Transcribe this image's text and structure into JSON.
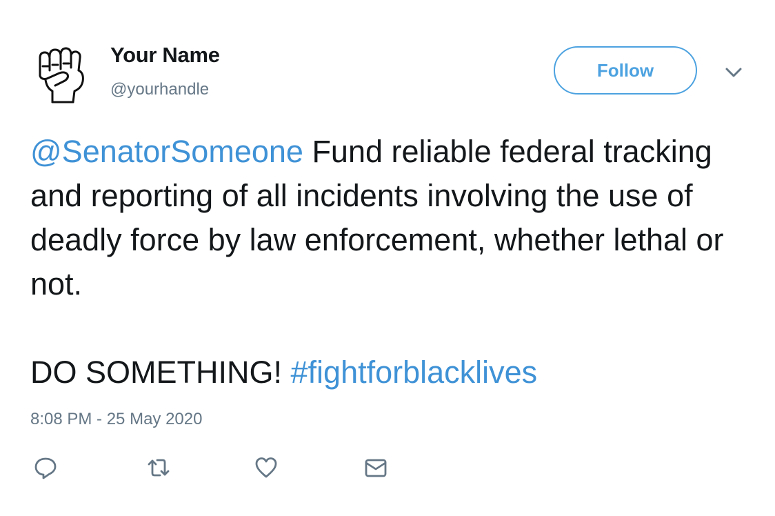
{
  "user": {
    "name": "Your Name",
    "handle": "@yourhandle",
    "avatar_icon": "raised-fist-icon"
  },
  "follow_label": "Follow",
  "menu_icon": "chevron-down-icon",
  "tweet": {
    "mention": "@SenatorSomeone",
    "text_line": " Fund reliable federal tracking and reporting of all incidents involving the use of deadly force by law enforcement, whether lethal or not.",
    "call_to_action": "DO SOMETHING! ",
    "hashtag": "#fightforblacklives",
    "timestamp": "8:08 PM - 25 May 2020"
  },
  "actions": {
    "reply_icon": "reply-icon",
    "retweet_icon": "retweet-icon",
    "like_icon": "heart-icon",
    "message_icon": "envelope-icon"
  },
  "colors": {
    "link": "#3f92d6",
    "follow_border": "#4ca2e0",
    "text": "#14171a",
    "muted": "#657786",
    "icon": "#657786"
  }
}
